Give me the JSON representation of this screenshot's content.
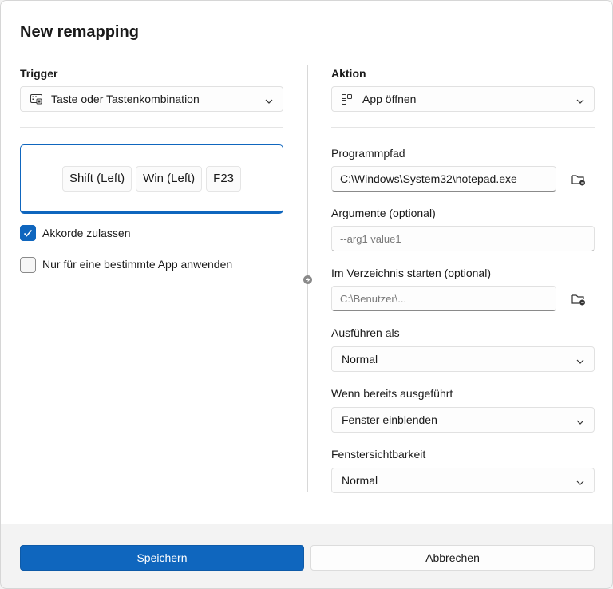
{
  "dialog": {
    "title": "New remapping"
  },
  "trigger": {
    "section_label": "Trigger",
    "type_select": {
      "value": "Taste oder Tastenkombination",
      "icon": "keyboard-icon"
    },
    "keys": [
      "Shift (Left)",
      "Win (Left)",
      "F23"
    ],
    "allow_chords": {
      "label": "Akkorde zulassen",
      "checked": true
    },
    "app_specific": {
      "label": "Nur für eine bestimmte App anwenden",
      "checked": false
    }
  },
  "action": {
    "section_label": "Aktion",
    "type_select": {
      "value": "App öffnen",
      "icon": "app-icon"
    },
    "program_path": {
      "label": "Programmpfad",
      "value": "C:\\Windows\\System32\\notepad.exe"
    },
    "arguments": {
      "label": "Argumente (optional)",
      "placeholder": "--arg1 value1"
    },
    "start_dir": {
      "label": "Im Verzeichnis starten (optional)",
      "placeholder": "C:\\Benutzer\\..."
    },
    "run_as": {
      "label": "Ausführen als",
      "value": "Normal"
    },
    "if_running": {
      "label": "Wenn bereits ausgeführt",
      "value": "Fenster einblenden"
    },
    "window_visibility": {
      "label": "Fenstersichtbarkeit",
      "value": "Normal"
    }
  },
  "footer": {
    "save_label": "Speichern",
    "cancel_label": "Abbrechen"
  },
  "colors": {
    "accent": "#0f66be",
    "background": "#f3f3f3",
    "surface": "#ffffff"
  }
}
